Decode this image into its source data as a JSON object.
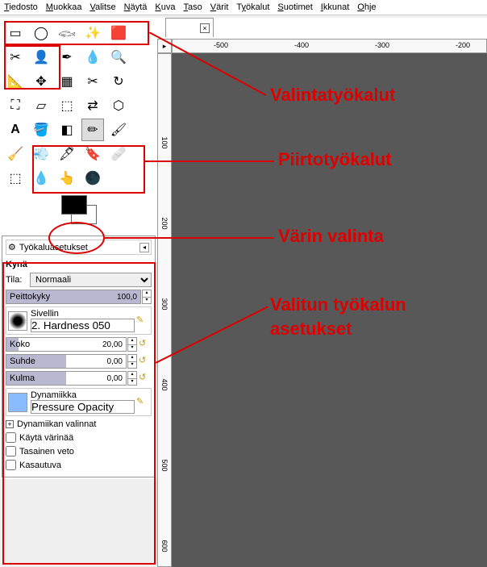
{
  "menu": [
    "Tiedosto",
    "Muokkaa",
    "Valitse",
    "Näytä",
    "Kuva",
    "Taso",
    "Värit",
    "Työkalut",
    "Suotimet",
    "Ikkunat",
    "Ohje"
  ],
  "tool_options": {
    "panel_title": "Työkaluasetukset",
    "tool_name": "Kynä",
    "mode_label": "Tila:",
    "mode_value": "Normaali",
    "opacity_label": "Peittokyky",
    "opacity_value": "100,0",
    "brush_label": "Sivellin",
    "brush_name": "2. Hardness 050",
    "size_label": "Koko",
    "size_value": "20,00",
    "ratio_label": "Suhde",
    "ratio_value": "0,00",
    "angle_label": "Kulma",
    "angle_value": "0,00",
    "dynamics_label": "Dynamiikka",
    "dynamics_value": "Pressure Opacity",
    "dyn_options": "Dynamiikan valinnat",
    "jitter": "Käytä värinää",
    "smooth": "Tasainen veto",
    "incremental": "Kasautuva"
  },
  "ruler_h": [
    "-500",
    "-400",
    "-300",
    "-200"
  ],
  "ruler_v": [
    "100",
    "200",
    "300",
    "400",
    "500",
    "600"
  ],
  "annotations": {
    "selection": "Valintatyökalut",
    "drawing": "Piirtotyökalut",
    "color": "Värin valinta",
    "options1": "Valitun työkalun",
    "options2": "asetukset"
  }
}
